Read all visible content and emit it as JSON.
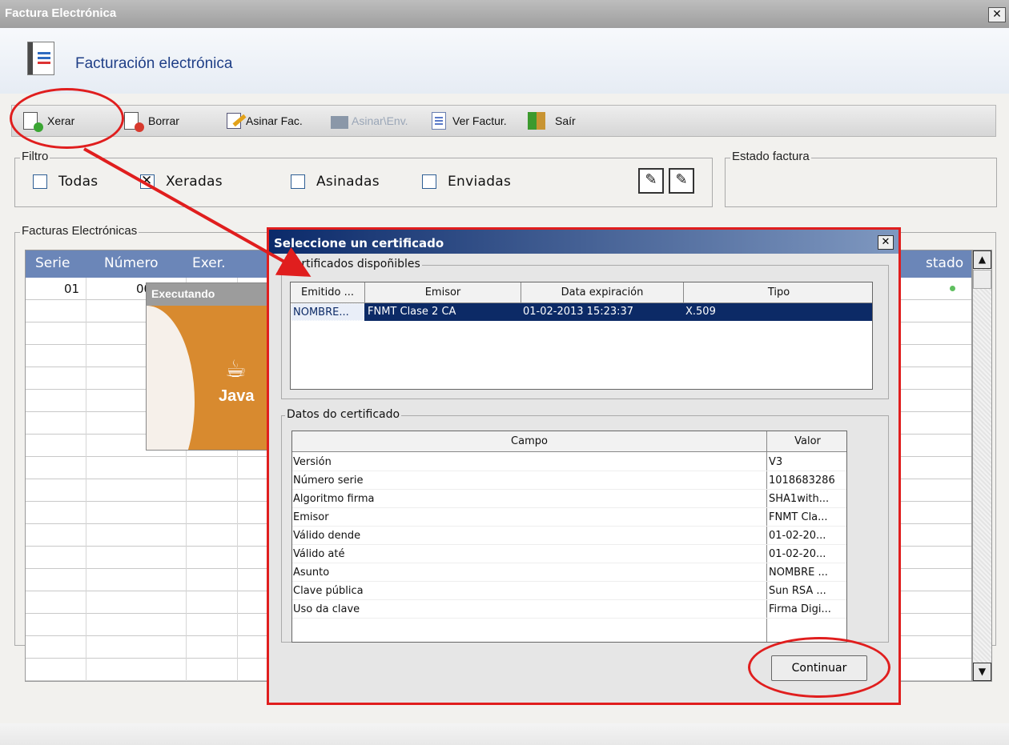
{
  "window": {
    "title": "Factura Electrónica",
    "close": "✕"
  },
  "header": {
    "title": "Facturación electrónica"
  },
  "toolbar": {
    "xerar": "Xerar",
    "borrar": "Borrar",
    "asinar_fac": "Asinar Fac.",
    "asinar_env": "Asinar\\Env.",
    "ver_factur": "Ver Factur.",
    "sair": "Saír"
  },
  "filtro": {
    "legend": "Filtro",
    "todas": "Todas",
    "xeradas": "Xeradas",
    "asinadas": "Asinadas",
    "enviadas": "Enviadas"
  },
  "estado_factura": {
    "legend": "Estado factura"
  },
  "facturas": {
    "legend": "Facturas Electrónicas",
    "columns": {
      "serie": "Serie",
      "numero": "Número",
      "exer": "Exer.",
      "estado": "stado"
    },
    "row1": {
      "serie": "01",
      "numero": "00"
    }
  },
  "splash": {
    "title": "Executando",
    "logo": "Java"
  },
  "dialog": {
    "title": "Seleccione un certificado",
    "close": "✕",
    "certs_legend": "Certificados dispoñibles",
    "certs_columns": [
      "Emitido ...",
      "Emisor",
      "Data expiración",
      "Tipo"
    ],
    "cert_row": [
      "NOMBRE...",
      "FNMT Clase 2 CA",
      "01-02-2013 15:23:37",
      "X.509"
    ],
    "datos_legend": "Datos do certificado",
    "datos_columns": [
      "Campo",
      "Valor"
    ],
    "datos_rows": [
      [
        "Versión",
        "V3"
      ],
      [
        "Número serie",
        "1018683286"
      ],
      [
        "Algoritmo firma",
        "SHA1with..."
      ],
      [
        "Emisor",
        "FNMT Cla..."
      ],
      [
        "Válido dende",
        "01-02-20..."
      ],
      [
        "Válido até",
        "01-02-20..."
      ],
      [
        "Asunto",
        "NOMBRE ..."
      ],
      [
        "Clave pública",
        "Sun RSA ..."
      ],
      [
        "Uso da clave",
        "Firma Digi..."
      ]
    ],
    "continuar": "Continuar"
  },
  "colors": {
    "annotation": "#e01e1e",
    "grid_header": "#6b86b8",
    "selection": "#0c2a66"
  }
}
